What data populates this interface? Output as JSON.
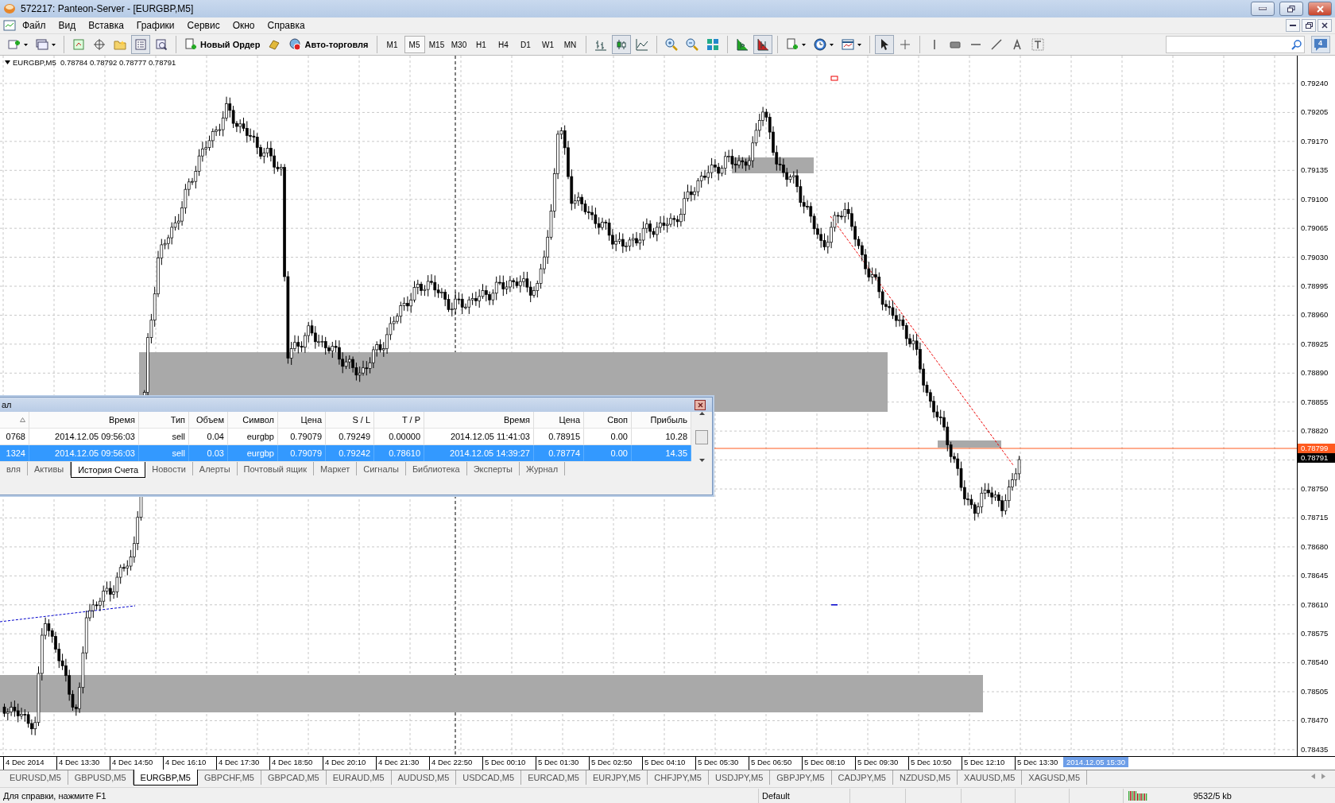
{
  "window": {
    "title": "572217: Panteon-Server - [EURGBP,M5]"
  },
  "menu": [
    "Файл",
    "Вид",
    "Вставка",
    "Графики",
    "Сервис",
    "Окно",
    "Справка"
  ],
  "toolbar": {
    "new_order": "Новый Ордер",
    "auto_trading": "Авто-торговля",
    "navigator_pressed": true,
    "autoscroll_pressed": true,
    "cursor_pressed": true,
    "timeframes": [
      {
        "label": "M1",
        "selected": false
      },
      {
        "label": "M5",
        "selected": true
      },
      {
        "label": "M15",
        "selected": false
      },
      {
        "label": "M30",
        "selected": false
      },
      {
        "label": "H1",
        "selected": false
      },
      {
        "label": "H4",
        "selected": false
      },
      {
        "label": "D1",
        "selected": false
      },
      {
        "label": "W1",
        "selected": false
      },
      {
        "label": "MN",
        "selected": false
      }
    ],
    "chart_types": [
      {
        "selected": false
      },
      {
        "selected": true
      },
      {
        "selected": false
      }
    ],
    "notifications": "4"
  },
  "chart": {
    "legend": "EURGBP,M5  0.78784 0.78792 0.78777 0.78791",
    "price_labels_upper": [
      "0.79240",
      "0.79205",
      "0.79170",
      "0.79135",
      "0.79100",
      "0.79065",
      "0.79030",
      "0.78995",
      "0.78960",
      "0.78925",
      "0.78890",
      "0.78855",
      "0.78820"
    ],
    "price_labels_lower": [
      "0.78750",
      "0.78715",
      "0.78680",
      "0.78645",
      "0.78610",
      "0.78575",
      "0.78540",
      "0.78505",
      "0.78470",
      "0.78435"
    ],
    "line_price": "0.78799",
    "current_price": "0.78791",
    "time_labels": [
      "4 Dec 2014",
      "4 Dec 13:30",
      "4 Dec 14:50",
      "4 Dec 16:10",
      "4 Dec 17:30",
      "4 Dec 18:50",
      "4 Dec 20:10",
      "4 Dec 21:30",
      "4 Dec 22:50",
      "5 Dec 00:10",
      "5 Dec 01:30",
      "5 Dec 02:50",
      "5 Dec 04:10",
      "5 Dec 05:30",
      "5 Dec 06:50",
      "5 Dec 08:10",
      "5 Dec 09:30",
      "5 Dec 10:50",
      "5 Dec 12:10",
      "5 Dec 13:30"
    ],
    "cursor_time": "2014.12.05 15:30"
  },
  "terminal": {
    "title": "ал",
    "columns": [
      "",
      "Время",
      "Тип",
      "Объем",
      "Символ",
      "Цена",
      "S / L",
      "T / P",
      "Время",
      "Цена",
      "Своп",
      "Прибыль"
    ],
    "rows": [
      {
        "selected": false,
        "cells": [
          "0768",
          "2014.12.05 09:56:03",
          "sell",
          "0.04",
          "eurgbp",
          "0.79079",
          "0.79249",
          "0.00000",
          "2014.12.05 11:41:03",
          "0.78915",
          "0.00",
          "10.28"
        ]
      },
      {
        "selected": true,
        "cells": [
          "1324",
          "2014.12.05 09:56:03",
          "sell",
          "0.03",
          "eurgbp",
          "0.79079",
          "0.79242",
          "0.78610",
          "2014.12.05 14:39:27",
          "0.78774",
          "0.00",
          "14.35"
        ]
      }
    ],
    "tabs": [
      {
        "label": "вля",
        "selected": false
      },
      {
        "label": "Активы",
        "selected": false
      },
      {
        "label": "История Счета",
        "selected": true
      },
      {
        "label": "Новости",
        "selected": false
      },
      {
        "label": "Алерты",
        "selected": false
      },
      {
        "label": "Почтовый ящик",
        "selected": false
      },
      {
        "label": "Маркет",
        "selected": false
      },
      {
        "label": "Сигналы",
        "selected": false
      },
      {
        "label": "Библиотека",
        "selected": false
      },
      {
        "label": "Эксперты",
        "selected": false
      },
      {
        "label": "Журнал",
        "selected": false
      }
    ]
  },
  "chart_tabs": [
    {
      "label": "EURUSD,M5",
      "selected": false
    },
    {
      "label": "GBPUSD,M5",
      "selected": false
    },
    {
      "label": "EURGBP,M5",
      "selected": true
    },
    {
      "label": "GBPCHF,M5",
      "selected": false
    },
    {
      "label": "GBPCAD,M5",
      "selected": false
    },
    {
      "label": "EURAUD,M5",
      "selected": false
    },
    {
      "label": "AUDUSD,M5",
      "selected": false
    },
    {
      "label": "USDCAD,M5",
      "selected": false
    },
    {
      "label": "EURCAD,M5",
      "selected": false
    },
    {
      "label": "EURJPY,M5",
      "selected": false
    },
    {
      "label": "CHFJPY,M5",
      "selected": false
    },
    {
      "label": "USDJPY,M5",
      "selected": false
    },
    {
      "label": "GBPJPY,M5",
      "selected": false
    },
    {
      "label": "CADJPY,M5",
      "selected": false
    },
    {
      "label": "NZDUSD,M5",
      "selected": false
    },
    {
      "label": "XAUUSD,M5",
      "selected": false
    },
    {
      "label": "XAGUSD,M5",
      "selected": false
    }
  ],
  "status_bar": {
    "help": "Для справки, нажмите F1",
    "profile": "Default",
    "traffic": "9532/5 kb"
  }
}
